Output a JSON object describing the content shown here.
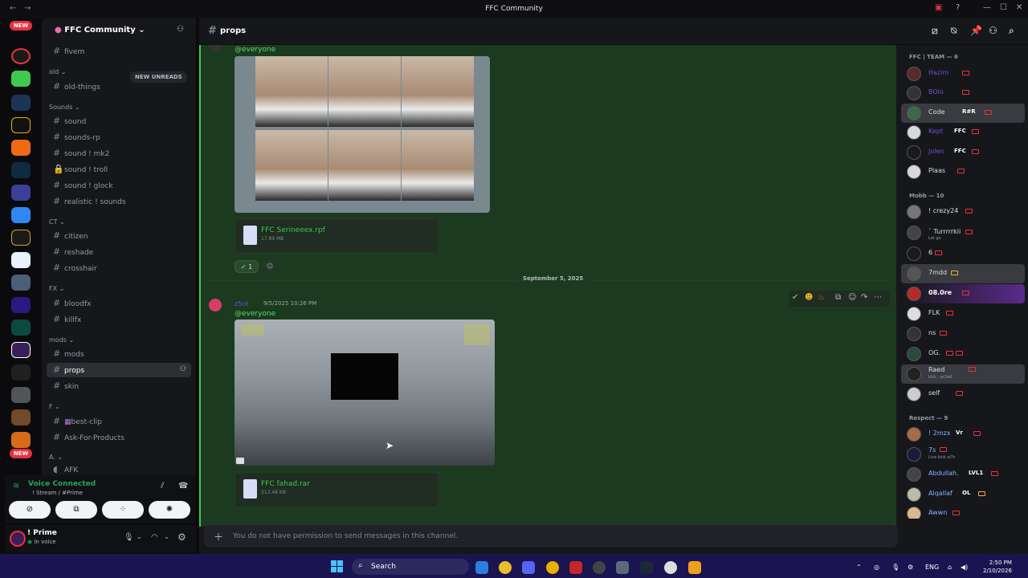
{
  "window": {
    "title": "FFC Community",
    "back": "←",
    "forward": "→"
  },
  "servers": {
    "new_top": "NEW",
    "new_bottom": "NEW",
    "badge_count": "2"
  },
  "server": {
    "name": "FFC Community",
    "new_unreads": "NEW UNREADS"
  },
  "channels": {
    "categories": [
      "old",
      "Sounds",
      "CT",
      "FX",
      "mods",
      "F",
      "A."
    ],
    "items": [
      "fivem",
      "old-things",
      "sound",
      "sounds-rp",
      "sound ! mk2",
      "sound ! troll",
      "sound ! glock",
      "realistic ! sounds",
      "citizen",
      "reshade",
      "crosshair",
      "bloodfx",
      "killfx",
      "mods",
      "props",
      "skin",
      "best-clip",
      "Ask-For-Products",
      "AFK"
    ]
  },
  "voice": {
    "status": "Voice Connected",
    "subtitle": "! Stream / #Prime"
  },
  "user": {
    "name": "! Prime",
    "status": "In voice"
  },
  "channel_header": {
    "name": "props"
  },
  "messages": {
    "mention1": "@everyone",
    "file1": {
      "name": "FFC Serineeex.rpf",
      "size": "17.89 MB"
    },
    "reaction_count": "1",
    "date_divider": "September 5, 2025",
    "msg2": {
      "author": "z5nt",
      "timestamp": "9/5/2025 10:26 PM",
      "mention": "@everyone"
    },
    "file2": {
      "name": "FFC fahad.rar",
      "size": "213.48 KB"
    }
  },
  "composer": {
    "placeholder": "You do not have permission to send messages in this channel."
  },
  "members": {
    "roles": [
      "FFC | TEAM — 6",
      "Mobb — 10",
      "Respect — 9"
    ],
    "team": [
      {
        "name": "Hazim",
        "tag": ""
      },
      {
        "name": "BOlo",
        "tag": ""
      },
      {
        "name": "Code",
        "tag": "R#R"
      },
      {
        "name": "Kept",
        "tag": "FFC"
      },
      {
        "name": "Jolen",
        "tag": "FFC"
      },
      {
        "name": "Plaas",
        "tag": ""
      }
    ],
    "mobb": [
      {
        "name": "! crezy24",
        "sub": ""
      },
      {
        "name": "` Turrrrrkii",
        "sub": "Let go"
      },
      {
        "name": "6",
        "sub": ""
      },
      {
        "name": "7mdd",
        "sub": ""
      },
      {
        "name": "08.0re",
        "sub": ""
      },
      {
        "name": "FLK",
        "sub": ""
      },
      {
        "name": "ns",
        "sub": ""
      },
      {
        "name": "OG.",
        "sub": ""
      },
      {
        "name": "Raed",
        "sub": "kick : ar2ed"
      },
      {
        "name": "self",
        "sub": ""
      }
    ],
    "respect": [
      {
        "name": "! 2mzx",
        "sub": "",
        "tag": "Vr"
      },
      {
        "name": "7s",
        "sub": "Live kick xi7s",
        "tag": ""
      },
      {
        "name": "Abdullah.",
        "sub": "",
        "tag": "LVL1"
      },
      {
        "name": "Alqallaf",
        "sub": "",
        "tag": "OL"
      },
      {
        "name": "Awwn",
        "sub": "",
        "tag": ""
      }
    ],
    "tag_vr": "Vr"
  },
  "taskbar": {
    "search": "Search",
    "lang": "ENG",
    "time": "2:50 PM",
    "date": "2/10/2026"
  }
}
